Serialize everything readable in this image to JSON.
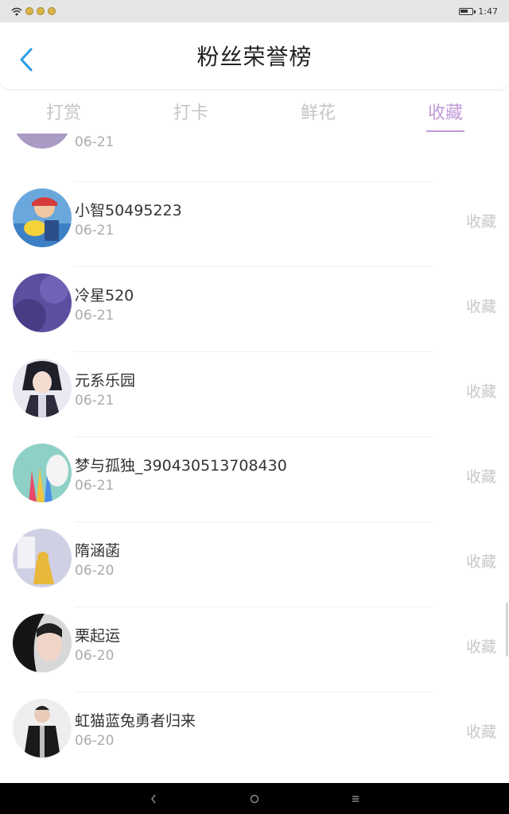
{
  "status_bar": {
    "time": "1:47",
    "icons": [
      "wifi-icon",
      "notification-icon",
      "notification-icon",
      "notification-icon",
      "battery-icon"
    ],
    "battery_level": 0.7
  },
  "header": {
    "back_icon": "chevron-left-icon",
    "title": "粉丝荣誉榜",
    "accent_color": "#2b9be6"
  },
  "tabs": [
    {
      "label": "打赏",
      "active": false
    },
    {
      "label": "打卡",
      "active": false
    },
    {
      "label": "鲜花",
      "active": false
    },
    {
      "label": "收藏",
      "active": true
    }
  ],
  "active_tab_color": "#c39ad9",
  "list": {
    "partial_top_date": "06-21",
    "items": [
      {
        "name": "小智50495223",
        "date": "06-21",
        "action": "收藏"
      },
      {
        "name": "冷星520",
        "date": "06-21",
        "action": "收藏"
      },
      {
        "name": "元系乐园",
        "date": "06-21",
        "action": "收藏"
      },
      {
        "name": "梦与孤独_390430513708430",
        "date": "06-21",
        "action": "收藏"
      },
      {
        "name": "隋涵菡",
        "date": "06-20",
        "action": "收藏"
      },
      {
        "name": "栗起运",
        "date": "06-20",
        "action": "收藏"
      },
      {
        "name": "虹猫蓝兔勇者归来",
        "date": "06-20",
        "action": "收藏"
      }
    ]
  },
  "nav_bar": {
    "buttons": [
      "nav-back-icon",
      "nav-home-icon",
      "nav-menu-icon"
    ]
  }
}
